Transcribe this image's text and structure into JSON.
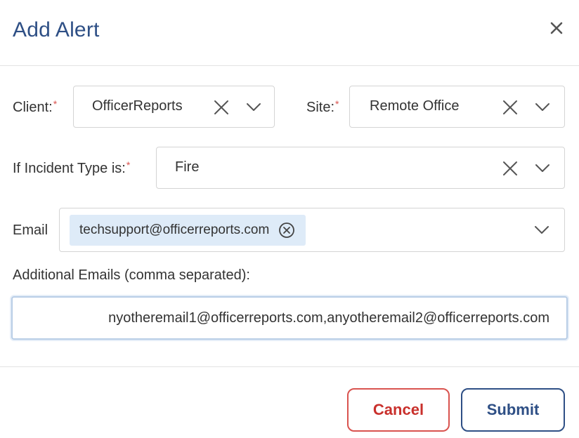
{
  "dialog": {
    "title": "Add Alert",
    "close_icon": "close-icon"
  },
  "form": {
    "client": {
      "label": "Client:",
      "required_mark": "*",
      "value": "OfficerReports"
    },
    "site": {
      "label": "Site:",
      "required_mark": "*",
      "value": "Remote Office"
    },
    "incident_type": {
      "label": "If Incident Type is:",
      "required_mark": "*",
      "value": "Fire"
    },
    "email": {
      "label": "Email",
      "chips": [
        "techsupport@officerreports.com"
      ]
    },
    "additional_emails": {
      "label": "Additional Emails (comma separated):",
      "value": "nyotheremail1@officerreports.com,anyotheremail2@officerreports.com"
    }
  },
  "footer": {
    "cancel_label": "Cancel",
    "submit_label": "Submit"
  },
  "colors": {
    "title": "#2e4f85",
    "required": "#d9534f",
    "chip_bg": "#deebf8",
    "cancel": "#c9302c",
    "submit": "#2e4f85"
  }
}
